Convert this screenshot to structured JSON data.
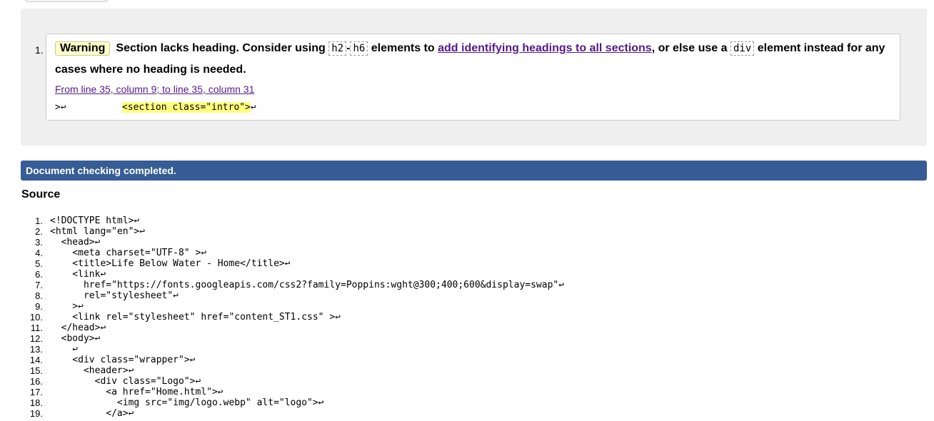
{
  "message": {
    "number": "1.",
    "severity": "Warning",
    "text_before": "Section lacks heading. Consider using ",
    "code_h2": "h2",
    "dash": "-",
    "code_h6": "h6",
    "text_mid": " elements to ",
    "link_text": "add identifying headings to all sections",
    "text_after": ", or else use a ",
    "code_div": "div",
    "text_end": " element instead for any",
    "text_line2": "cases where no heading is needed.",
    "location": "From line 35, column 9; to line 35, column 31",
    "extract_prefix": ">↩          ",
    "extract_highlight": "<section class=\"intro\">",
    "extract_suffix": "↩"
  },
  "status": "Document checking completed.",
  "source": {
    "heading": "Source",
    "lines": [
      {
        "n": "1.",
        "code": "<!DOCTYPE html>↩"
      },
      {
        "n": "2.",
        "code": "<html lang=\"en\">↩"
      },
      {
        "n": "3.",
        "code": "  <head>↩"
      },
      {
        "n": "4.",
        "code": "    <meta charset=\"UTF-8\" >↩"
      },
      {
        "n": "5.",
        "code": "    <title>Life Below Water - Home</title>↩"
      },
      {
        "n": "6.",
        "code": "    <link↩"
      },
      {
        "n": "7.",
        "code": "      href=\"https://fonts.googleapis.com/css2?family=Poppins:wght@300;400;600&display=swap\"↩"
      },
      {
        "n": "8.",
        "code": "      rel=\"stylesheet\"↩"
      },
      {
        "n": "9.",
        "code": "    >↩"
      },
      {
        "n": "10.",
        "code": "    <link rel=\"stylesheet\" href=\"content_ST1.css\" >↩"
      },
      {
        "n": "11.",
        "code": "  </head>↩"
      },
      {
        "n": "12.",
        "code": "  <body>↩"
      },
      {
        "n": "13.",
        "code": "    ↩"
      },
      {
        "n": "14.",
        "code": "    <div class=\"wrapper\">↩"
      },
      {
        "n": "15.",
        "code": "      <header>↩"
      },
      {
        "n": "16.",
        "code": "        <div class=\"Logo\">↩"
      },
      {
        "n": "17.",
        "code": "          <a href=\"Home.html\">↩"
      },
      {
        "n": "18.",
        "code": "            <img src=\"img/logo.webp\" alt=\"logo\">↩"
      },
      {
        "n": "19.",
        "code": "          </a>↩"
      }
    ]
  }
}
